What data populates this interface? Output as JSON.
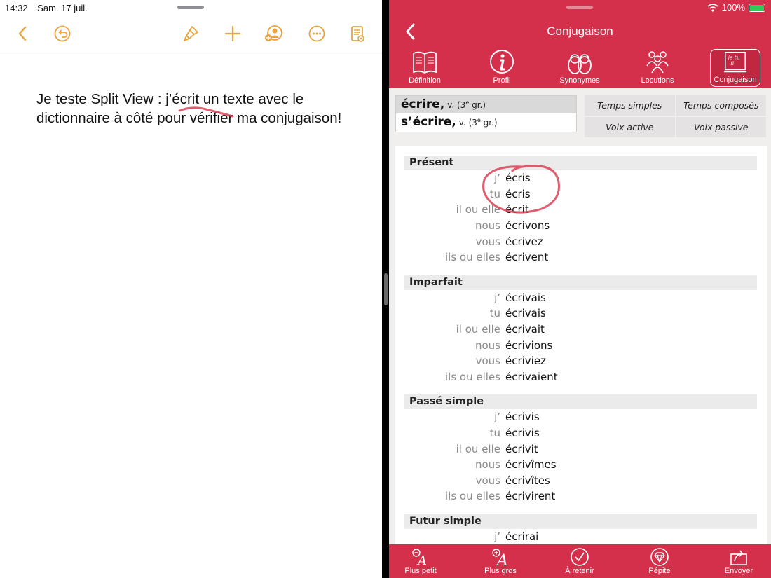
{
  "left_pane": {
    "status": {
      "time": "14:32",
      "date": "Sam. 17 juil."
    },
    "toolbar": {
      "back": "chevron-left-icon",
      "undo": "undo-icon",
      "format": "paintbrush-icon",
      "insert": "plus-icon",
      "collaborate": "collaborate-icon",
      "more": "more-icon",
      "document": "document-icon"
    },
    "document_text": "Je teste Split View : j’écrit un texte avec le dictionnaire à côté pour vérifier ma conjugaison!"
  },
  "right_pane": {
    "status": {
      "battery": "100%"
    },
    "header": {
      "title": "Conjugaison"
    },
    "tabs": [
      {
        "label": "Définition",
        "icon": "book-icon"
      },
      {
        "label": "Profil",
        "icon": "info-icon"
      },
      {
        "label": "Synonymes",
        "icon": "dolls-icon"
      },
      {
        "label": "Locutions",
        "icon": "group-icon"
      },
      {
        "label": "Conjugaison",
        "icon": "conjugation-icon"
      }
    ],
    "entries": [
      {
        "word": "écrire,",
        "gram": "v. (3",
        "sup": "e",
        "gram_end": "gr.)"
      },
      {
        "word": "s’écrire,",
        "gram": "v. (3",
        "sup": "e",
        "gram_end": "gr.)"
      }
    ],
    "segments": {
      "temps_simples": "Temps simples",
      "temps_composes": "Temps composés",
      "voix_active": "Voix active",
      "voix_passive": "Voix passive"
    },
    "tenses": [
      {
        "name": "Présent",
        "rows": [
          {
            "pronoun": "j’",
            "form": "écris"
          },
          {
            "pronoun": "tu",
            "form": "écris"
          },
          {
            "pronoun": "il ou elle",
            "form": "écrit"
          },
          {
            "pronoun": "nous",
            "form": "écrivons"
          },
          {
            "pronoun": "vous",
            "form": "écrivez"
          },
          {
            "pronoun": "ils ou elles",
            "form": "écrivent"
          }
        ]
      },
      {
        "name": "Imparfait",
        "rows": [
          {
            "pronoun": "j’",
            "form": "écrivais"
          },
          {
            "pronoun": "tu",
            "form": "écrivais"
          },
          {
            "pronoun": "il ou elle",
            "form": "écrivait"
          },
          {
            "pronoun": "nous",
            "form": "écrivions"
          },
          {
            "pronoun": "vous",
            "form": "écriviez"
          },
          {
            "pronoun": "ils ou elles",
            "form": "écrivaient"
          }
        ]
      },
      {
        "name": "Passé simple",
        "rows": [
          {
            "pronoun": "j’",
            "form": "écrivis"
          },
          {
            "pronoun": "tu",
            "form": "écrivis"
          },
          {
            "pronoun": "il ou elle",
            "form": "écrivit"
          },
          {
            "pronoun": "nous",
            "form": "écrivîmes"
          },
          {
            "pronoun": "vous",
            "form": "écrivîtes"
          },
          {
            "pronoun": "ils ou elles",
            "form": "écrivirent"
          }
        ]
      },
      {
        "name": "Futur simple",
        "rows": [
          {
            "pronoun": "j’",
            "form": "écrirai"
          }
        ]
      }
    ],
    "bottom_bar": [
      {
        "label": "Plus petit",
        "icon": "text-smaller-icon"
      },
      {
        "label": "Plus gros",
        "icon": "text-bigger-icon"
      },
      {
        "label": "À retenir",
        "icon": "checkmark-icon"
      },
      {
        "label": "Pépite",
        "icon": "diamond-icon"
      },
      {
        "label": "Envoyer",
        "icon": "share-icon"
      }
    ],
    "colors": {
      "brand_red": "#d4304c",
      "accent_orange": "#e8a33c"
    }
  }
}
